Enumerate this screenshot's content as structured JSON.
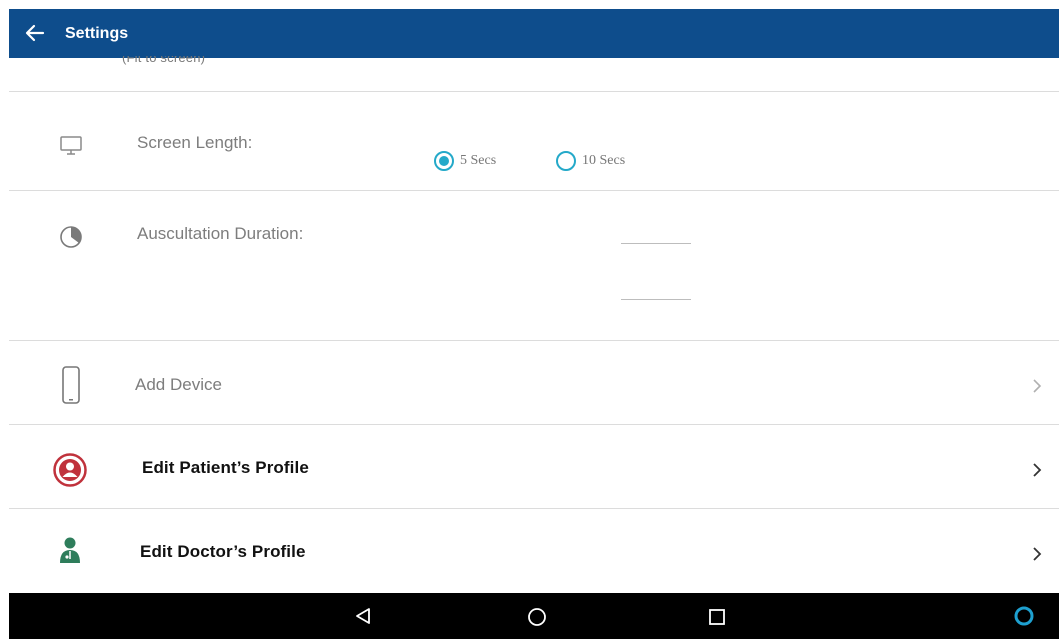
{
  "appbar": {
    "title": "Settings",
    "back_icon": "arrow-left-icon"
  },
  "clipped_text": "(Fit to screen)",
  "screen_length": {
    "label": "Screen Length:",
    "icon": "monitor-icon",
    "options": [
      {
        "label": "5 Secs",
        "selected": true
      },
      {
        "label": "10 Secs",
        "selected": false
      }
    ],
    "accent": "#24a9c9"
  },
  "auscultation": {
    "label": "Auscultation Duration:",
    "icon": "pie-icon",
    "field1_value": "",
    "field2_value": ""
  },
  "menu": [
    {
      "label": "Add Device",
      "icon": "phone-icon",
      "enabled": false
    },
    {
      "label": "Edit Patient’s Profile",
      "icon": "patient-profile-icon",
      "enabled": true
    },
    {
      "label": "Edit Doctor’s Profile",
      "icon": "doctor-icon",
      "enabled": true
    }
  ],
  "colors": {
    "appbar": "#0e4d8c",
    "patient_icon": "#c0323c",
    "doctor_icon": "#2e7d5b",
    "nav_accent": "#1ea0d0"
  },
  "navbar": {
    "buttons": [
      "back-triangle-icon",
      "home-circle-icon",
      "recents-square-icon",
      "assistant-icon"
    ]
  }
}
